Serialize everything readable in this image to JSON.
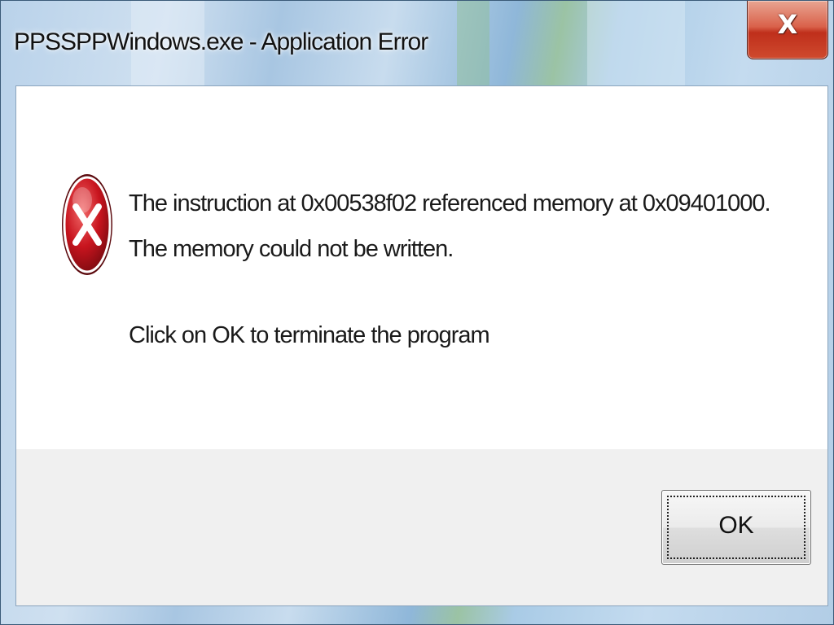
{
  "window": {
    "title": "PPSSPPWindows.exe - Application Error",
    "close_glyph": "X"
  },
  "dialog": {
    "icon": "error-icon",
    "message": "The instruction at 0x00538f02 referenced memory at 0x09401000. The memory could not be written.",
    "prompt": "Click on OK to terminate the program",
    "ok_label": "OK"
  },
  "colors": {
    "close_button": "#c8391f",
    "error_icon": "#c8141e",
    "button_area": "#f0f0f0"
  }
}
